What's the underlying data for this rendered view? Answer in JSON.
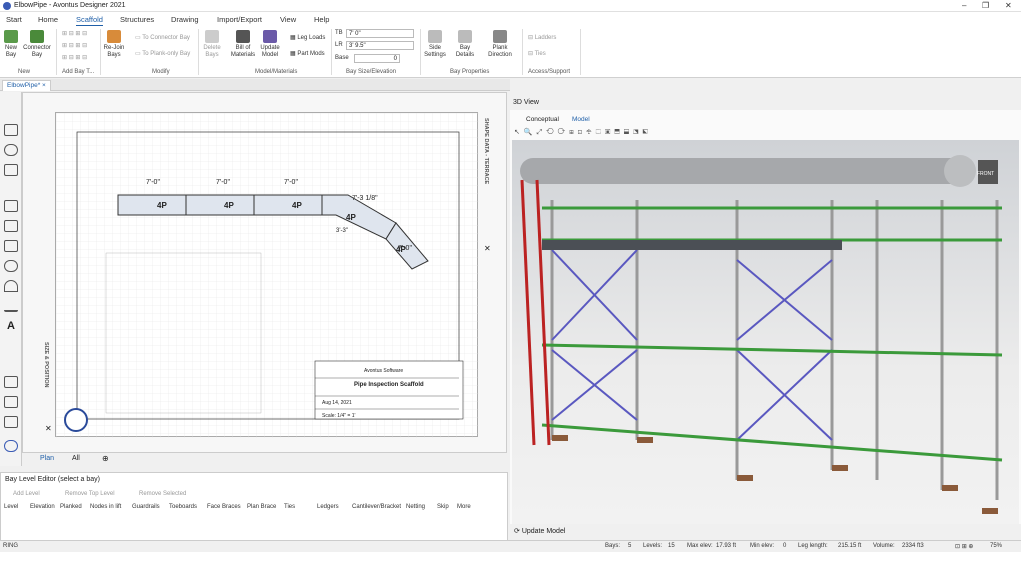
{
  "app": {
    "title": "ElbowPipe - Avontus Designer 2021"
  },
  "menu": [
    "Start",
    "Home",
    "Scaffold",
    "Structures",
    "Drawing",
    "Import/Export",
    "View",
    "Help"
  ],
  "active_menu": "Scaffold",
  "ribbon": {
    "new_bay": "New Bay",
    "connector_bay": "Connector Bay",
    "rejoin_bays": "Re-Join Bays",
    "to_connector": "To Connector Bay",
    "to_plank": "To Plank-only Bay",
    "delete_bays": "Delete Bays",
    "bom": "Bill of Materials",
    "update_model": "Update Model",
    "leg_loads": "Leg Loads",
    "part_mods": "Part Mods",
    "tb_label": "TB",
    "tb_value": "7' 0\"",
    "lr_label": "LR",
    "lr_value": "3' 9.5\"",
    "base_label": "Base",
    "base_value": "0",
    "side_settings": "Side Settings",
    "bay_details": "Bay Details",
    "plank_direction": "Plank Direction",
    "ladders": "Ladders",
    "ties": "Ties",
    "groups": [
      "New",
      "Add Bay T...",
      "Modify",
      "Model/Materials",
      "Bay Size/Elevation",
      "Bay Properties",
      "Access/Support"
    ]
  },
  "doc_tab": "ElbowPipe*",
  "plan": {
    "side_tab_top": "SHAPE DATA - TERRACE",
    "side_tab_left": "SIZE & POSITION",
    "dims": [
      "7'-0\"",
      "7'-0\"",
      "7'-0\"",
      "7'-3 1/8\"",
      "7'-0\"",
      "3'-3\"",
      "4'-1 1/4\""
    ],
    "bay_labels": [
      "4P",
      "4P",
      "4P",
      "4P",
      "4P"
    ],
    "title_block": {
      "company": "Avontus Software",
      "title": "Pipe Inspection Scaffold",
      "date": "Aug 14, 2021",
      "scale": "Scale: 1/4\" = 1'"
    },
    "bar": {
      "tab_plan": "Plan",
      "tab_all": "All"
    }
  },
  "bay_editor": {
    "title": "Bay Level Editor (select a bay)",
    "add_level": "Add Level",
    "remove_top": "Remove Top Level",
    "remove_selected": "Remove Selected",
    "columns": [
      "Level",
      "Elevation",
      "Planked",
      "Nodes in lift",
      "Guardrails",
      "Toeboards",
      "Face Braces",
      "Plan Brace",
      "Ties",
      "Ledgers",
      "Cantilever/Bracket",
      "Netting",
      "Skip",
      "More"
    ]
  },
  "view3d": {
    "title": "3D View",
    "tab_conceptual": "Conceptual",
    "tab_model": "Model",
    "front_label": "FRONT",
    "update_model": "Update Model"
  },
  "status": {
    "ring": "RING",
    "bays_label": "Bays:",
    "bays": "5",
    "levels_label": "Levels:",
    "levels": "15",
    "maxelev_label": "Max elev:",
    "maxelev": "17.93 ft",
    "minelev_label": "Min elev:",
    "minelev": "0",
    "leglen_label": "Leg length:",
    "leglen": "215.15 ft",
    "volume_label": "Volume:",
    "volume": "2334 ft3",
    "zoom": "75%"
  }
}
